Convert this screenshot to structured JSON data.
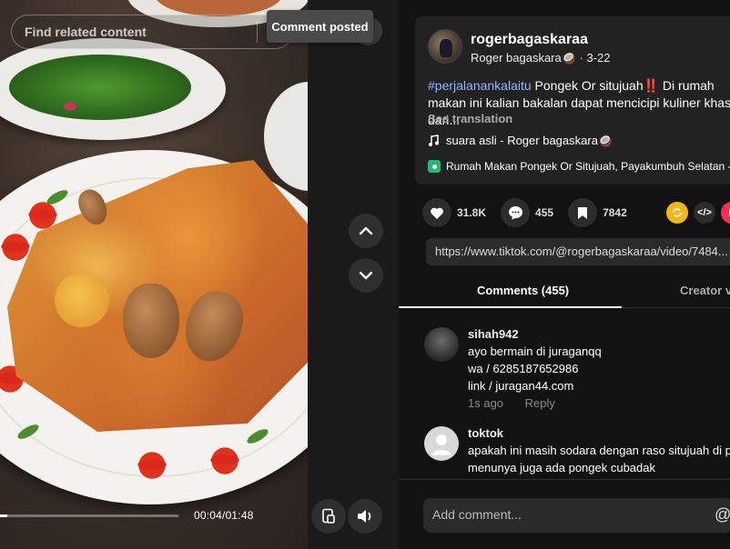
{
  "search": {
    "placeholder": "Find related content"
  },
  "toast": {
    "text": "Comment posted"
  },
  "player": {
    "time": "00:04/01:48",
    "progress": 0.04
  },
  "post": {
    "username": "rogerbagaskaraa",
    "display_name": "Roger bagaskara🥥",
    "date": "3-22",
    "hashtag": "#perjalanankalaitu",
    "description": " Pongek Or situjuah‼️ Di rumah makan ini kalian bakalan dapat mencicipi kuliner khas dari...",
    "see_translation": "See translation",
    "music": "suara asli - Roger bagaskara🥥",
    "location": "Rumah Makan Pongek Or Situjuah, Payakumbuh Selatan - Payakumbuh"
  },
  "stats": {
    "likes": "31.8K",
    "comments": "455",
    "saves": "7842"
  },
  "share": {
    "embed_icon": "</>"
  },
  "url": "https://www.tiktok.com/@rogerbagaskaraa/video/7484...",
  "tabs": {
    "comments": "Comments (455)",
    "creator": "Creator videos"
  },
  "comments": [
    {
      "user": "sihah942",
      "lines": [
        "ayo bermain di juraganqq",
        "wa / 6285187652986",
        "link / juragan44.com"
      ],
      "time": "1s ago",
      "reply": "Reply"
    },
    {
      "user": "toktok",
      "lines": [
        "apakah ini masih sodara dengan raso situjuah di pertigaan",
        "menunya juga ada pongek cubadak"
      ],
      "time": "",
      "reply": ""
    }
  ],
  "footer": {
    "placeholder": "Add comment...",
    "mention": "@"
  },
  "colors": {
    "background": "#121212",
    "panel": "#222222",
    "hashtag": "#8fb7ff",
    "location_pin": "#25b87a"
  }
}
